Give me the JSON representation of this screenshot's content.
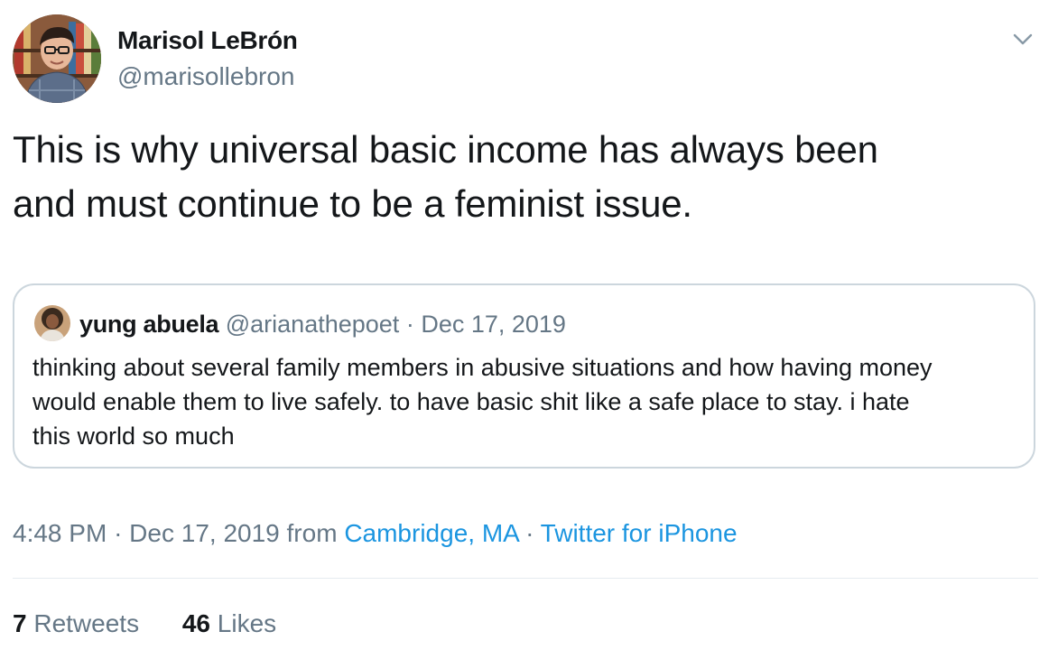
{
  "author": {
    "name": "Marisol LeBrón",
    "handle": "@marisollebron"
  },
  "tweet": {
    "text_line1": "This is why universal basic income has always been",
    "text_line2": "and must continue to be a feminist issue."
  },
  "quoted_tweet": {
    "name": "yung abuela",
    "handle": "@arianathepoet",
    "separator": "·",
    "date": "Dec 17, 2019",
    "text_line1": "thinking about several family members in abusive situations and how having money",
    "text_line2": "would enable them to live safely. to have basic shit like a safe place to stay. i hate",
    "text_line3": "this world so much"
  },
  "meta": {
    "time": "4:48 PM",
    "separator1": "·",
    "date": "Dec 17, 2019",
    "from": "from",
    "location": "Cambridge, MA",
    "separator2": "·",
    "source": "Twitter for iPhone"
  },
  "stats": {
    "retweets_count": "7",
    "retweets_label": "Retweets",
    "likes_count": "46",
    "likes_label": "Likes"
  },
  "colors": {
    "link": "#1b95e0",
    "secondary_text": "#657786",
    "primary_text": "#14171a",
    "border": "#ccd6dd"
  },
  "icons": {
    "more": "chevron-down-icon"
  }
}
